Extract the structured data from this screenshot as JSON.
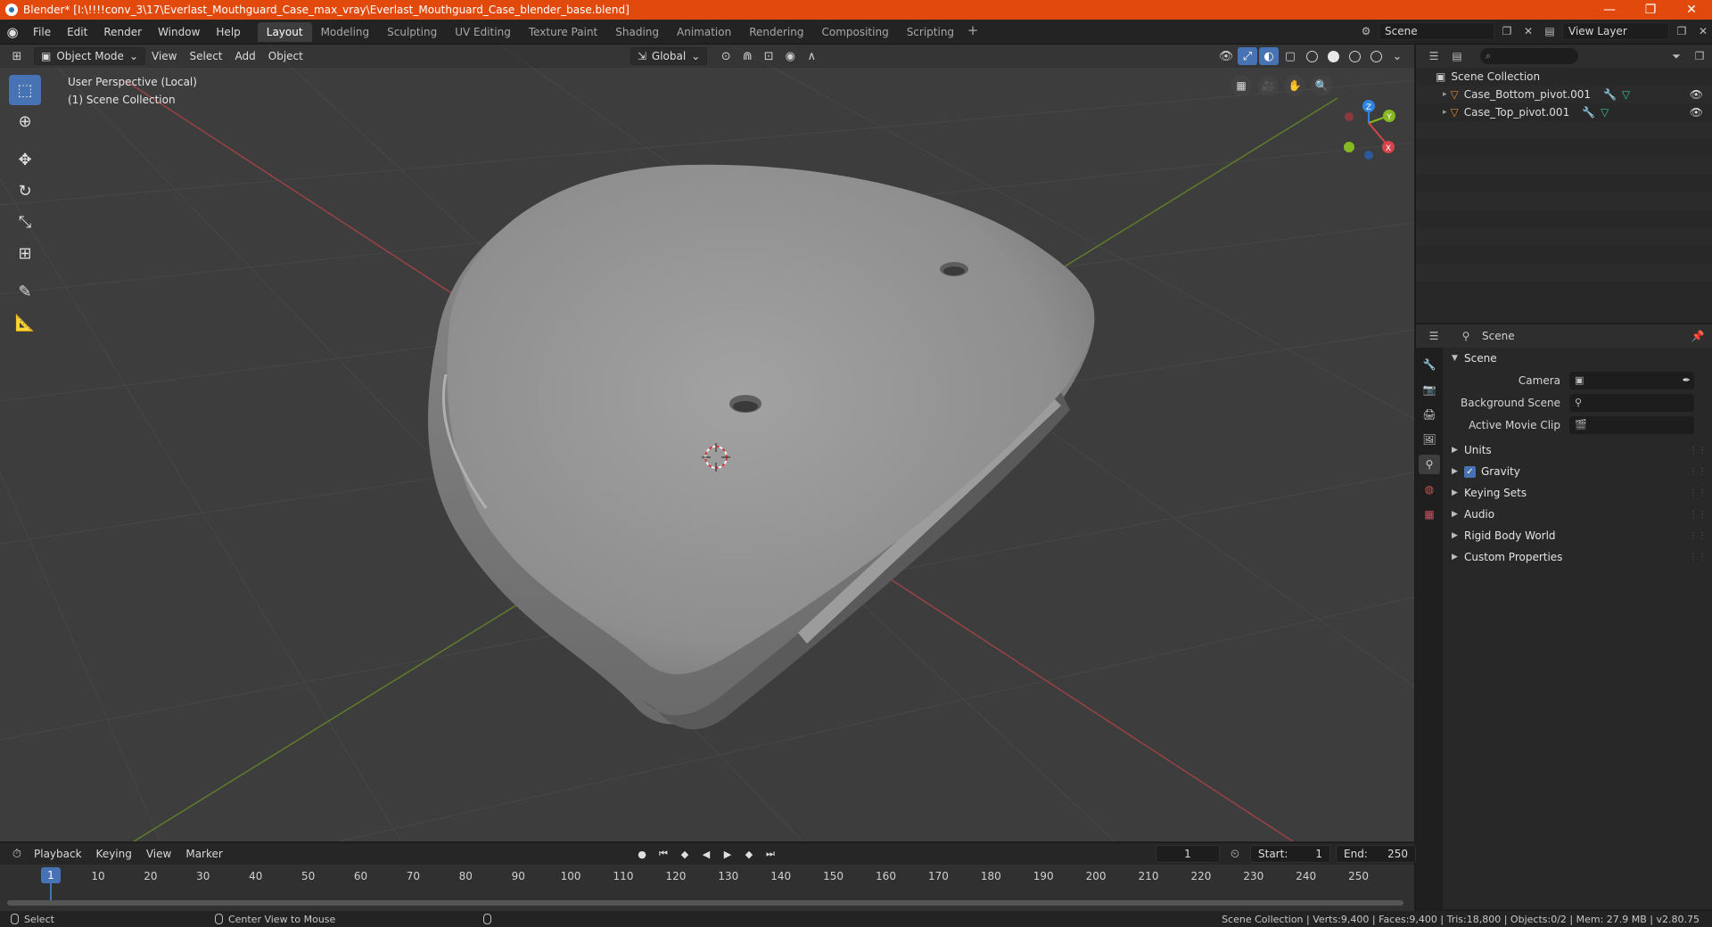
{
  "window": {
    "title": "Blender* [I:\\!!!!conv_3\\17\\Everlast_Mouthguard_Case_max_vray\\Everlast_Mouthguard_Case_blender_base.blend]",
    "minimize": "—",
    "maximize": "❐",
    "close": "✕"
  },
  "menu": [
    "File",
    "Edit",
    "Render",
    "Window",
    "Help"
  ],
  "workspaces": [
    "Layout",
    "Modeling",
    "Sculpting",
    "UV Editing",
    "Texture Paint",
    "Shading",
    "Animation",
    "Rendering",
    "Compositing",
    "Scripting"
  ],
  "active_workspace": "Layout",
  "topright": {
    "scene": "Scene",
    "view_layer": "View Layer"
  },
  "viewport": {
    "mode": "Object Mode",
    "menus": [
      "View",
      "Select",
      "Add",
      "Object"
    ],
    "orientation": "Global",
    "info_line1": "User Perspective (Local)",
    "info_line2": "(1) Scene Collection",
    "gizmo_axes": {
      "z": "Z",
      "y": "Y",
      "x": "X"
    }
  },
  "outliner": {
    "root": "Scene Collection",
    "items": [
      "Case_Bottom_pivot.001",
      "Case_Top_pivot.001"
    ],
    "search_placeholder": ""
  },
  "properties": {
    "header": "Scene",
    "panel": "Scene",
    "fields": [
      {
        "label": "Camera",
        "value": ""
      },
      {
        "label": "Background Scene",
        "value": ""
      },
      {
        "label": "Active Movie Clip",
        "value": ""
      }
    ],
    "sections": [
      "Units",
      "Gravity",
      "Keying Sets",
      "Audio",
      "Rigid Body World",
      "Custom Properties"
    ],
    "gravity_checked": true
  },
  "timeline": {
    "menus": [
      "Playback",
      "Keying",
      "View",
      "Marker"
    ],
    "current_frame": "1",
    "start_label": "Start:",
    "start": "1",
    "end_label": "End:",
    "end": "250",
    "ticks": [
      "10",
      "20",
      "30",
      "40",
      "50",
      "60",
      "70",
      "80",
      "90",
      "100",
      "110",
      "120",
      "130",
      "140",
      "150",
      "160",
      "170",
      "180",
      "190",
      "200",
      "210",
      "220",
      "230",
      "240",
      "250"
    ]
  },
  "statusbar": {
    "left1": "Select",
    "left2": "Center View to Mouse",
    "right": "Scene Collection | Verts:9,400 | Faces:9,400 | Tris:18,800 | Objects:0/2 | Mem: 27.9 MB | v2.80.75"
  },
  "colors": {
    "titlebar": "#e24a0d",
    "accent": "#4772b3",
    "x_axis": "#d5444b",
    "y_axis": "#86b820",
    "z_axis": "#2f83e3"
  }
}
